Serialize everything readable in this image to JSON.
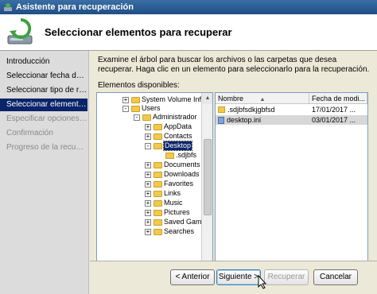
{
  "window": {
    "title": "Asistente para recuperación"
  },
  "header": {
    "title": "Seleccionar elementos para recuperar"
  },
  "nav": {
    "items": [
      {
        "label": "Introducción",
        "state": "normal"
      },
      {
        "label": "Seleccionar fecha de c...",
        "state": "normal"
      },
      {
        "label": "Seleccionar tipo de rec...",
        "state": "normal"
      },
      {
        "label": "Seleccionar elementos ...",
        "state": "active"
      },
      {
        "label": "Especificar opciones de...",
        "state": "disabled"
      },
      {
        "label": "Confirmación",
        "state": "disabled"
      },
      {
        "label": "Progreso de la recuper...",
        "state": "disabled"
      }
    ]
  },
  "content": {
    "instructions": "Examine el árbol para buscar los archivos o las carpetas que desea recuperar. Haga clic en un elemento para seleccionarlo para la recuperación.",
    "available_label": "Elementos disponibles:"
  },
  "tree": {
    "rows": [
      {
        "label": "System Volume Infor",
        "level": 0,
        "expander": "+",
        "selected": false
      },
      {
        "label": "Users",
        "level": 0,
        "expander": "-",
        "selected": false
      },
      {
        "label": "Administrador",
        "level": 1,
        "expander": "-",
        "selected": false
      },
      {
        "label": "AppData",
        "level": 2,
        "expander": "+",
        "selected": false
      },
      {
        "label": "Contacts",
        "level": 2,
        "expander": "+",
        "selected": false
      },
      {
        "label": "Desktop",
        "level": 2,
        "expander": "-",
        "selected": true
      },
      {
        "label": ".sdjbfs",
        "level": 3,
        "expander": "",
        "selected": false
      },
      {
        "label": "Documents",
        "level": 2,
        "expander": "+",
        "selected": false
      },
      {
        "label": "Downloads",
        "level": 2,
        "expander": "+",
        "selected": false
      },
      {
        "label": "Favorites",
        "level": 2,
        "expander": "+",
        "selected": false
      },
      {
        "label": "Links",
        "level": 2,
        "expander": "+",
        "selected": false
      },
      {
        "label": "Music",
        "level": 2,
        "expander": "+",
        "selected": false
      },
      {
        "label": "Pictures",
        "level": 2,
        "expander": "+",
        "selected": false
      },
      {
        "label": "Saved Gam",
        "level": 2,
        "expander": "+",
        "selected": false
      },
      {
        "label": "Searches",
        "level": 2,
        "expander": "+",
        "selected": false
      }
    ]
  },
  "files": {
    "columns": [
      "Nombre",
      "Fecha de modi..."
    ],
    "sort_indicator": "▲",
    "rows": [
      {
        "name": ".sdjbfsdkjgbfsd",
        "date": "17/01/2017 ...",
        "icon": "folder-icon",
        "selected": false
      },
      {
        "name": "desktop.ini",
        "date": "03/01/2017 ...",
        "icon": "ini-file-icon",
        "selected": true
      }
    ]
  },
  "buttons": {
    "back": "< Anterior",
    "next": "Siguiente >",
    "recover": "Recuperar",
    "cancel": "Cancelar"
  },
  "colors": {
    "title_bar": "#1f4e85",
    "selection": "#0a246a",
    "folder": "#f2c94c"
  }
}
